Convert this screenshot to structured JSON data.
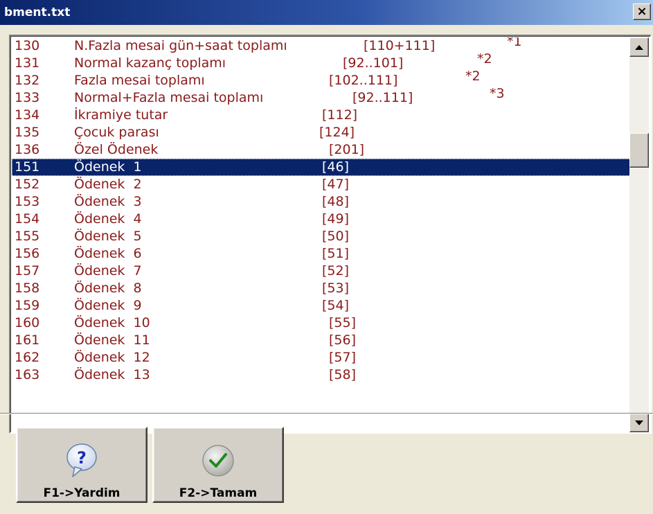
{
  "window": {
    "title": "bment.txt",
    "close_label": "×"
  },
  "list": {
    "selected_index": 7,
    "rows": [
      {
        "code": "130",
        "name": "N.Fazla mesai gün+saat toplamı",
        "ref": "[110+111]",
        "note": "*1"
      },
      {
        "code": "131",
        "name": "Normal kazanç toplamı",
        "ref": "[92..101]",
        "note": "*2"
      },
      {
        "code": "132",
        "name": "Fazla mesai toplamı",
        "ref": "[102..111]",
        "note": "*2"
      },
      {
        "code": "133",
        "name": "Normal+Fazla mesai toplamı",
        "ref": "[92..111]",
        "note": "*3"
      },
      {
        "code": "134",
        "name": "İkramiye tutar",
        "ref": "[112]",
        "note": ""
      },
      {
        "code": "135",
        "name": "Çocuk parası",
        "ref": "[124]",
        "note": ""
      },
      {
        "code": "136",
        "name": "Özel Ödenek",
        "ref": "[201]",
        "note": ""
      },
      {
        "code": "151",
        "name": "Ödenek  1",
        "ref": "[46]",
        "note": ""
      },
      {
        "code": "152",
        "name": "Ödenek  2",
        "ref": "[47]",
        "note": ""
      },
      {
        "code": "153",
        "name": "Ödenek  3",
        "ref": "[48]",
        "note": ""
      },
      {
        "code": "154",
        "name": "Ödenek  4",
        "ref": "[49]",
        "note": ""
      },
      {
        "code": "155",
        "name": "Ödenek  5",
        "ref": "[50]",
        "note": ""
      },
      {
        "code": "156",
        "name": "Ödenek  6",
        "ref": "[51]",
        "note": ""
      },
      {
        "code": "157",
        "name": "Ödenek  7",
        "ref": "[52]",
        "note": ""
      },
      {
        "code": "158",
        "name": "Ödenek  8",
        "ref": "[53]",
        "note": ""
      },
      {
        "code": "159",
        "name": "Ödenek  9",
        "ref": "[54]",
        "note": ""
      },
      {
        "code": "160",
        "name": "Ödenek  10",
        "ref": "[55]",
        "note": ""
      },
      {
        "code": "161",
        "name": "Ödenek  11",
        "ref": "[56]",
        "note": ""
      },
      {
        "code": "162",
        "name": "Ödenek  12",
        "ref": "[57]",
        "note": ""
      },
      {
        "code": "163",
        "name": "Ödenek  13",
        "ref": "[58]",
        "note": ""
      }
    ]
  },
  "buttons": {
    "help_label": "F1->Yardim",
    "ok_label": "F2->Tamam",
    "help_icon": "help-bubble-icon",
    "ok_icon": "checkmark-icon"
  },
  "colors": {
    "title_bar": "#0a246a",
    "list_text": "#8b1a1a",
    "selection_bg": "#0a246a",
    "selection_text": "#ffffff",
    "face": "#d4d0c8"
  }
}
